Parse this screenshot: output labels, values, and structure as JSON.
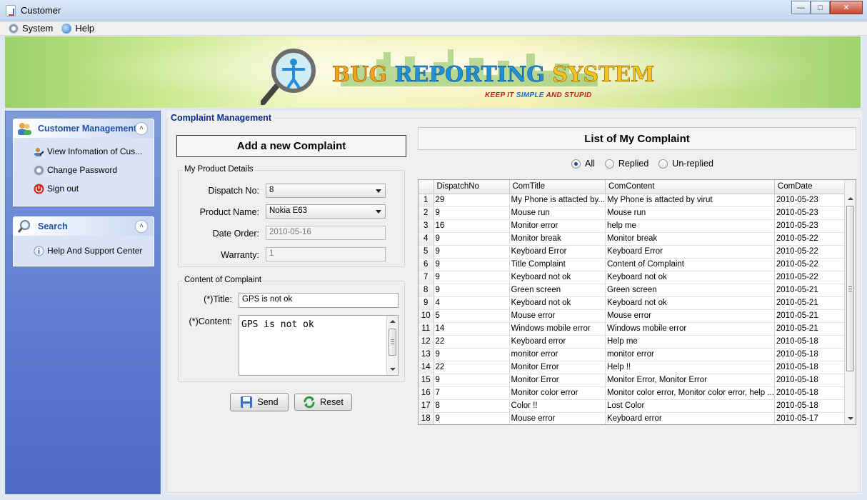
{
  "window": {
    "title": "Customer"
  },
  "menu": [
    {
      "label": "System",
      "icon": "gear-icon"
    },
    {
      "label": "Help",
      "icon": "help-icon"
    }
  ],
  "banner": {
    "title_w1": "BUG",
    "title_w2": "REPORTING",
    "title_w3": "SYSTEM",
    "slogan_a": "KEEP IT ",
    "slogan_b": "SIMPLE",
    "slogan_c": " AND STUPID"
  },
  "sidebar": {
    "customer_management": {
      "title": "Customer Management",
      "items": [
        {
          "label": "View Infomation of Cus...",
          "icon": "user-edit-icon"
        },
        {
          "label": "Change Password",
          "icon": "gear-icon"
        },
        {
          "label": "Sign out",
          "icon": "power-icon"
        }
      ]
    },
    "search": {
      "title": "Search",
      "items": [
        {
          "label": "Help And Support Center",
          "icon": "info-icon"
        }
      ]
    }
  },
  "complaint": {
    "group_title": "Complaint Management",
    "add_title": "Add a new Complaint",
    "product_details": {
      "legend": "My Product Details",
      "dispatch_label": "Dispatch No:",
      "dispatch_value": "8",
      "product_label": "Product Name:",
      "product_value": "Nokia E63",
      "date_label": "Date Order:",
      "date_value": "2010-05-16",
      "warranty_label": "Warranty:",
      "warranty_value": "1"
    },
    "content": {
      "legend": "Content of Complaint",
      "title_label": "(*)Title:",
      "title_value": "GPS is not ok",
      "content_label": "(*)Content:",
      "content_value": "GPS is not ok"
    },
    "buttons": {
      "send": "Send",
      "reset": "Reset"
    }
  },
  "list": {
    "title": "List of My Complaint",
    "filters": [
      {
        "label": "All",
        "selected": true
      },
      {
        "label": "Replied",
        "selected": false
      },
      {
        "label": "Un-replied",
        "selected": false
      }
    ],
    "columns": [
      "DispatchNo",
      "ComTitle",
      "ComContent",
      "ComDate"
    ],
    "rows": [
      [
        "1",
        "29",
        "My Phone is attacted by...",
        "My Phone is attacted by virut",
        "2010-05-23"
      ],
      [
        "2",
        "9",
        "Mouse run",
        "Mouse run",
        "2010-05-23"
      ],
      [
        "3",
        "16",
        "Monitor error",
        "help me",
        "2010-05-23"
      ],
      [
        "4",
        "9",
        "Monitor break",
        "Monitor break",
        "2010-05-22"
      ],
      [
        "5",
        "9",
        "Keyboard Error",
        "Keyboard Error",
        "2010-05-22"
      ],
      [
        "6",
        "9",
        "Title Complaint",
        "Content of Complaint",
        "2010-05-22"
      ],
      [
        "7",
        "9",
        "Keyboard not ok",
        "Keyboard not ok",
        "2010-05-22"
      ],
      [
        "8",
        "9",
        "Green screen",
        "Green screen",
        "2010-05-21"
      ],
      [
        "9",
        "4",
        "Keyboard not ok",
        "Keyboard not ok",
        "2010-05-21"
      ],
      [
        "10",
        "5",
        "Mouse error",
        "Mouse error",
        "2010-05-21"
      ],
      [
        "11",
        "14",
        "Windows mobile error",
        "Windows mobile error",
        "2010-05-21"
      ],
      [
        "12",
        "22",
        "Keyboard error",
        "Help me",
        "2010-05-18"
      ],
      [
        "13",
        "9",
        "monitor error",
        "monitor error",
        "2010-05-18"
      ],
      [
        "14",
        "22",
        "Monitor Error",
        "Help !!",
        "2010-05-18"
      ],
      [
        "15",
        "9",
        "Monitor Error",
        "Monitor Error, Monitor Error",
        "2010-05-18"
      ],
      [
        "16",
        "7",
        "Monitor color error",
        "Monitor color error, Monitor color error, help ...",
        "2010-05-18"
      ],
      [
        "17",
        "8",
        "Color !!",
        "Lost Color",
        "2010-05-18"
      ],
      [
        "18",
        "9",
        "Mouse error",
        "Keyboard error",
        "2010-05-17"
      ]
    ]
  }
}
